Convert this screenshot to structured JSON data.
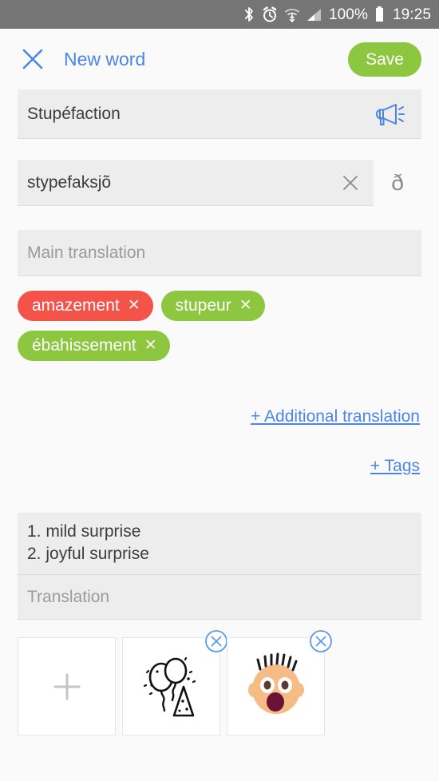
{
  "statusbar": {
    "icons": [
      "bluetooth-icon",
      "alarm-clock-icon",
      "wifi-icon",
      "signal-bars-icon"
    ],
    "battery_percent": "100%",
    "battery_icon": "battery-full-icon",
    "time": "19:25",
    "background": "#757575"
  },
  "appbar": {
    "close_icon": "close-icon",
    "title": "New word",
    "save_label": "Save",
    "title_color": "#4A86E8",
    "save_color": "#8DC63F"
  },
  "form": {
    "word": {
      "value": "Stupéfaction",
      "speak_icon": "megaphone-icon"
    },
    "transcription": {
      "value": "stypefaksjõ",
      "clear_icon": "clear-icon",
      "special_char": "ð"
    },
    "main_translation": {
      "placeholder": "Main translation",
      "value": ""
    },
    "chips": [
      {
        "label": "amazement",
        "color": "#F4534A",
        "remove_icon": "chip-remove-icon"
      },
      {
        "label": "stupeur",
        "color": "#8DC63F",
        "remove_icon": "chip-remove-icon"
      },
      {
        "label": "ébahissement",
        "color": "#8DC63F",
        "remove_icon": "chip-remove-icon"
      }
    ],
    "links": {
      "additional_translation": "+ Additional translation",
      "tags": "+ Tags"
    },
    "notes": {
      "line1": "1. mild surprise",
      "line2": "2. joyful surprise"
    },
    "translation": {
      "placeholder": "Translation",
      "value": ""
    },
    "images": [
      {
        "name": "add-image-card",
        "icon": "plus-icon",
        "removable": false
      },
      {
        "name": "image-card-balloons",
        "icon": "party-balloons-icon",
        "removable": true
      },
      {
        "name": "image-card-surprised-face",
        "icon": "surprised-face-icon",
        "removable": true
      }
    ]
  }
}
